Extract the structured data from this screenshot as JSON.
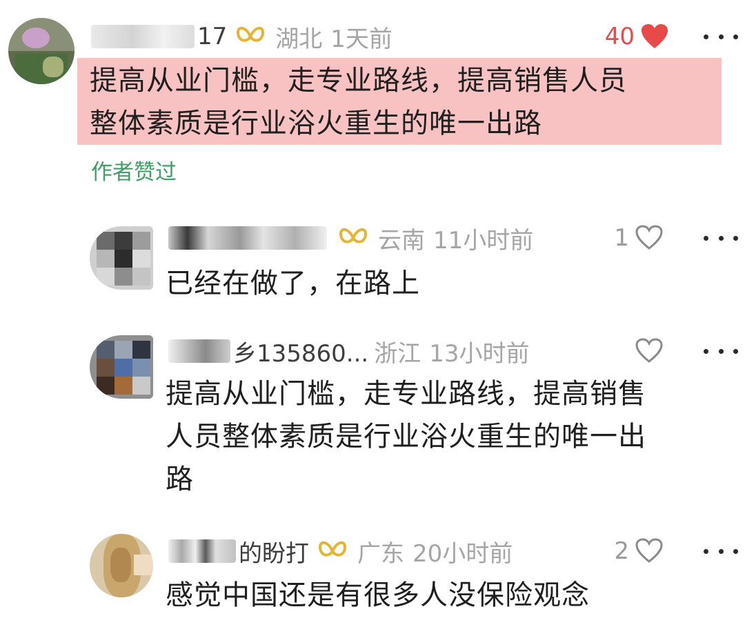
{
  "colors": {
    "liked_heart": "#e84a4a",
    "highlight": "#f9c2c2",
    "author_liked_text": "#3f9e66",
    "badge_gold": "#e6b332"
  },
  "comments": [
    {
      "name": "17",
      "location": "湖北",
      "time": "1天前",
      "likes": "40",
      "liked": true,
      "text_lines": [
        "提高从业门槛，走专业路线，提高销售人员",
        "整体素质是行业浴火重生的唯一出路"
      ],
      "author_liked": "作者赞过",
      "icons": [
        "badge-icon",
        "heart-filled-icon",
        "more-icon"
      ]
    },
    {
      "name": "",
      "location": "云南",
      "time": "11小时前",
      "likes": "1",
      "liked": false,
      "text_lines": [
        "已经在做了，在路上"
      ],
      "icons": [
        "badge-icon",
        "heart-outline-icon",
        "more-icon"
      ]
    },
    {
      "name": "乡135860...",
      "location": "浙江",
      "time": "13小时前",
      "likes": "",
      "liked": false,
      "text_lines": [
        "提高从业门槛，走专业路线，提高销售",
        "人员整体素质是行业浴火重生的唯一出",
        "路"
      ],
      "icons": [
        "heart-outline-icon",
        "more-icon"
      ]
    },
    {
      "name": "的盼打",
      "location": "广东",
      "time": "20小时前",
      "likes": "2",
      "liked": false,
      "text_lines": [
        "感觉中国还是有很多人没保险观念"
      ],
      "icons": [
        "badge-icon",
        "heart-outline-icon",
        "more-icon"
      ]
    }
  ]
}
